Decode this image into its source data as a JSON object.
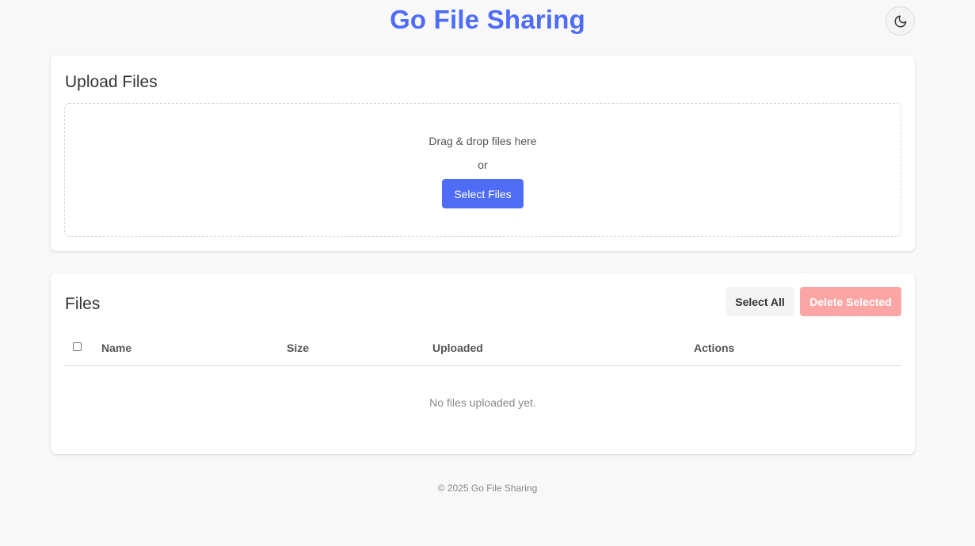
{
  "header": {
    "title": "Go File Sharing",
    "theme_toggle_icon": "moon-icon"
  },
  "upload": {
    "title": "Upload Files",
    "drop_text": "Drag & drop files here",
    "or_text": "or",
    "select_button_label": "Select Files"
  },
  "files": {
    "title": "Files",
    "select_all_label": "Select All",
    "delete_selected_label": "Delete Selected",
    "columns": [
      "Name",
      "Size",
      "Uploaded",
      "Actions"
    ],
    "rows": [],
    "empty_message": "No files uploaded yet."
  },
  "footer": {
    "text": "© 2025 Go File Sharing"
  },
  "colors": {
    "accent": "#4f6cf7",
    "danger_disabled": "#fca5a5",
    "background": "#f8f8f8"
  }
}
